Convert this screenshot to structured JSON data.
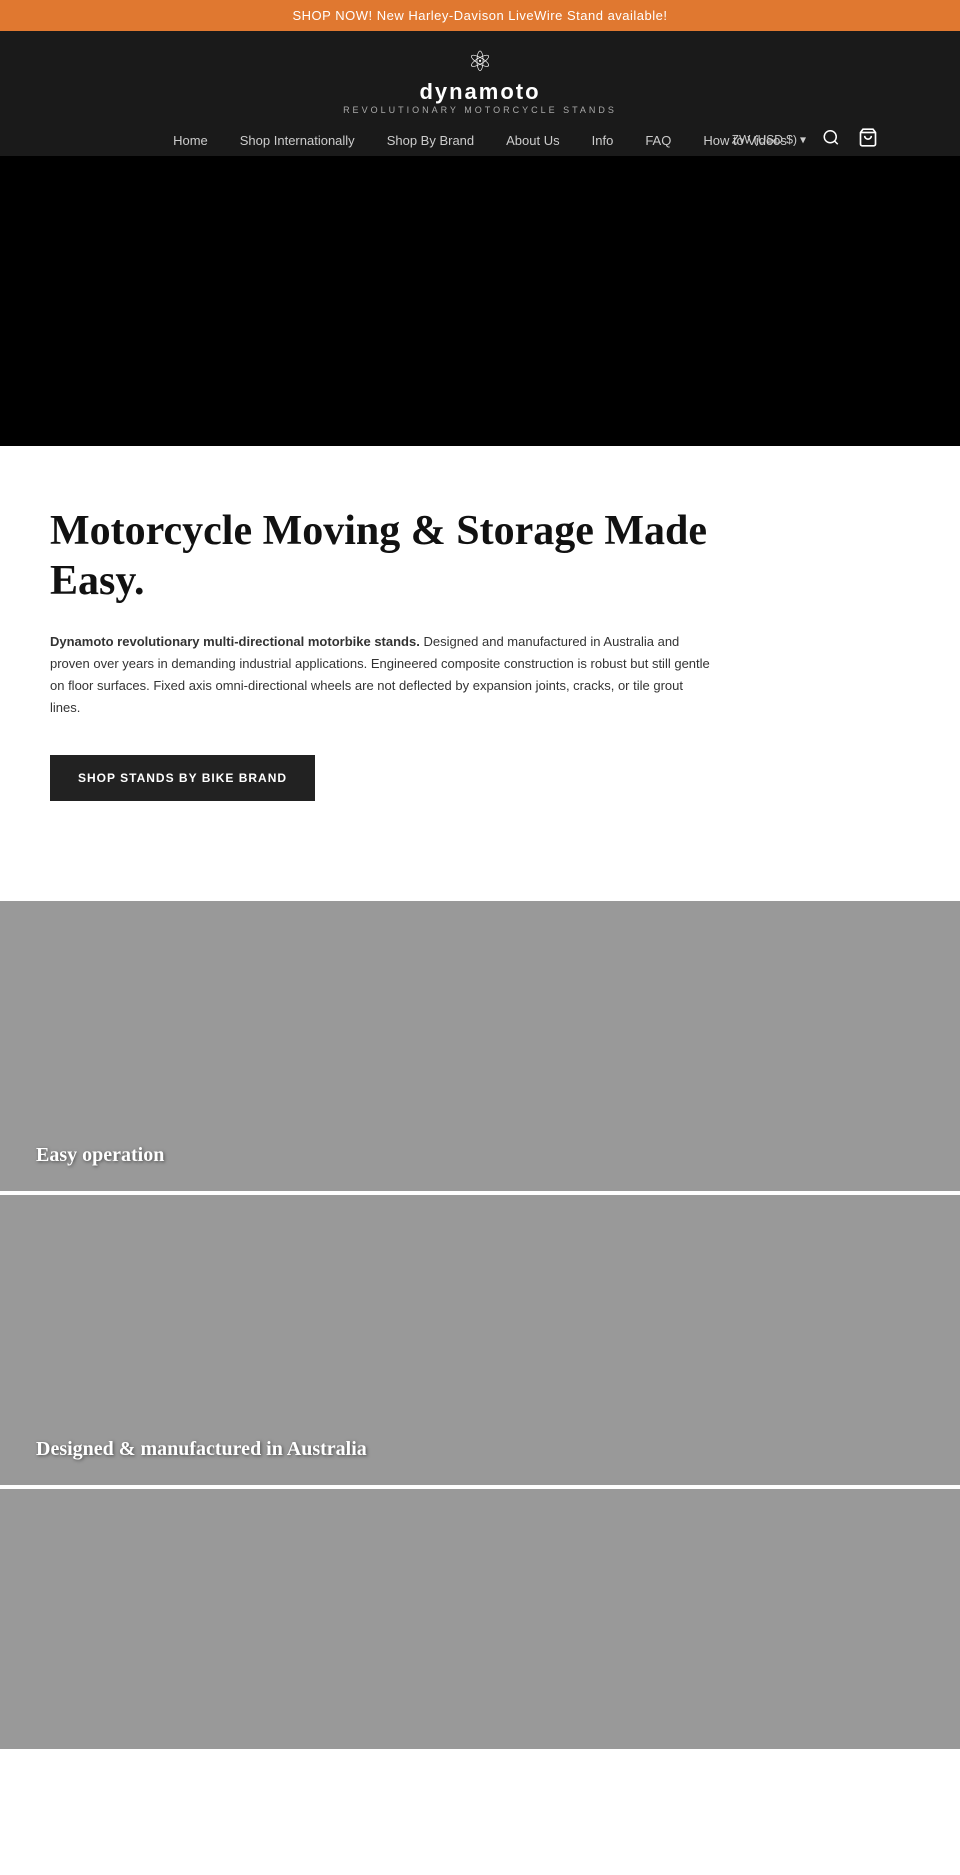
{
  "announcement": {
    "text": "SHOP NOW! New Harley-Davison LiveWire Stand available!"
  },
  "header": {
    "logo": {
      "name": "dynamoto",
      "tagline": "REVOLUTIONARY MOTORCYCLE STANDS"
    },
    "nav": [
      {
        "label": "Home",
        "id": "home"
      },
      {
        "label": "Shop Internationally",
        "id": "shop-internationally"
      },
      {
        "label": "Shop By Brand",
        "id": "shop-by-brand"
      },
      {
        "label": "About Us",
        "id": "about-us"
      },
      {
        "label": "Info",
        "id": "info"
      },
      {
        "label": "FAQ",
        "id": "faq"
      },
      {
        "label": "How to Videos",
        "id": "how-to-videos"
      }
    ],
    "currency": "ZW (USD $)",
    "currency_arrow": "▾"
  },
  "hero": {
    "alt": "Hero video placeholder"
  },
  "main": {
    "heading": "Motorcycle Moving & Storage Made Easy.",
    "intro_bold": "Dynamoto revolutionary multi-directional motorbike stands.",
    "intro_rest": " Designed and manufactured in Australia and proven over years in demanding industrial applications. Engineered composite construction is robust but still gentle on floor surfaces. Fixed axis omni-directional wheels are not deflected by expansion joints, cracks, or tile grout lines.",
    "cta_label": "SHOP STANDS BY BIKE BRAND"
  },
  "features": [
    {
      "label": "Easy operation",
      "id": "easy-operation"
    },
    {
      "label": "Designed & manufactured in Australia",
      "id": "designed-manufactured"
    },
    {
      "label": "",
      "id": "third-feature"
    }
  ],
  "icons": {
    "search": "🔍",
    "cart": "🛒",
    "atom": "⚛"
  }
}
